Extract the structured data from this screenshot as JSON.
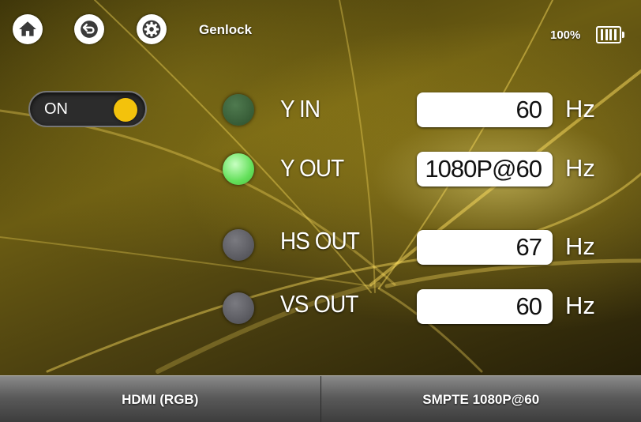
{
  "header": {
    "title": "Genlock",
    "battery_percent": "100%",
    "icons": [
      "home-icon",
      "back-icon",
      "gear-icon",
      "battery-icon"
    ]
  },
  "toggle": {
    "label": "ON",
    "state": "on",
    "knob_color": "#f3c20c"
  },
  "signals": [
    {
      "label": "Y IN",
      "value": "60",
      "unit": "Hz",
      "indicator": "dark-green"
    },
    {
      "label": "Y OUT",
      "value": "1080P@60",
      "unit": "Hz",
      "indicator": "bright-green"
    },
    {
      "label": "HS OUT",
      "value": "67",
      "unit": "Hz",
      "indicator": "grey"
    },
    {
      "label": "VS OUT",
      "value": "60",
      "unit": "Hz",
      "indicator": "grey"
    }
  ],
  "bottom_tabs": [
    "HDMI (RGB)",
    "SMPTE 1080P@60"
  ],
  "colors": {
    "accent": "#f3c20c",
    "indicator_on": "#64e05b"
  }
}
